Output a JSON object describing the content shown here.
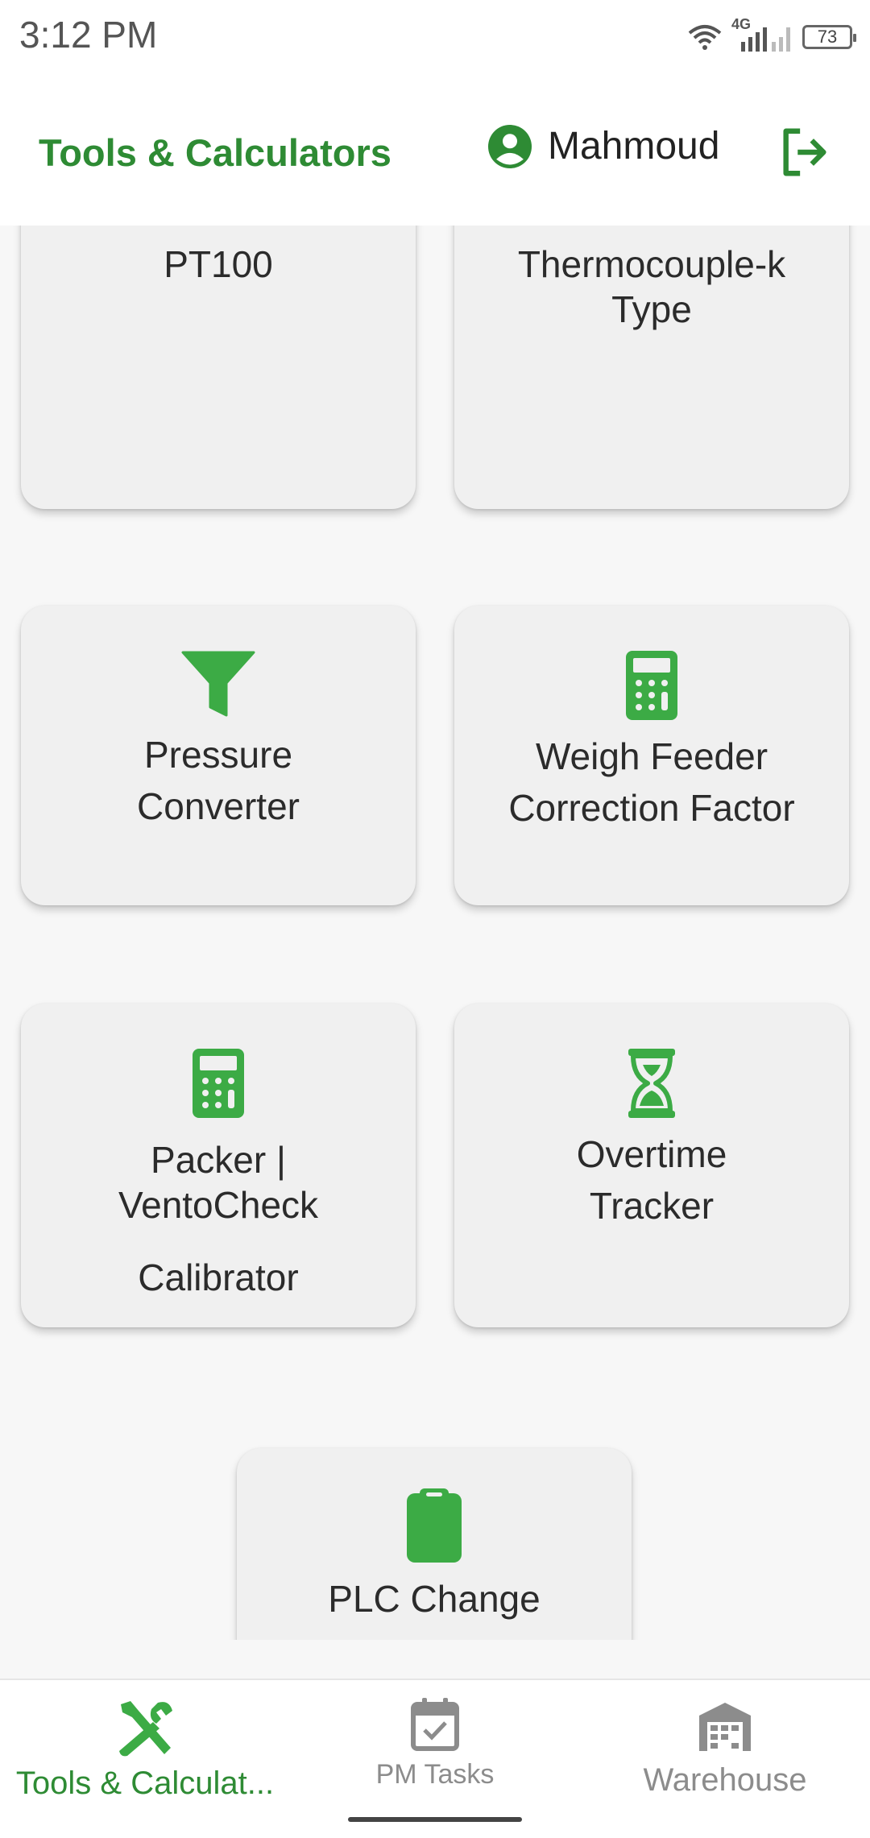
{
  "status_bar": {
    "time": "3:12 PM",
    "network": "4G",
    "battery": "73"
  },
  "header": {
    "title": "Tools & Calculators",
    "user_name": "Mahmoud"
  },
  "cards": [
    {
      "label_lines": [
        "PT100"
      ]
    },
    {
      "label_lines": [
        "Thermocouple-k",
        "Type"
      ]
    },
    {
      "label_lines": [
        "Pressure",
        "Converter"
      ],
      "icon": "filter-icon"
    },
    {
      "label_lines": [
        "Weigh Feeder",
        "Correction Factor"
      ],
      "icon": "calculator-icon"
    },
    {
      "label_lines": [
        "Packer |",
        "VentoCheck",
        "Calibrator"
      ],
      "icon": "calculator-icon"
    },
    {
      "label_lines": [
        "Overtime",
        "Tracker"
      ],
      "icon": "hourglass-icon"
    },
    {
      "label_lines": [
        "PLC Change"
      ],
      "icon": "clipboard-icon"
    }
  ],
  "bottom_nav": [
    {
      "label": "Tools & Calculat...",
      "icon": "tools-icon",
      "active": true
    },
    {
      "label": "PM Tasks",
      "icon": "calendar-check-icon",
      "active": false
    },
    {
      "label": "Warehouse",
      "icon": "warehouse-icon",
      "active": false
    }
  ],
  "colors": {
    "accent": "#2e8b34",
    "icon_green": "#3cab45",
    "inactive": "#8c8c8c"
  }
}
